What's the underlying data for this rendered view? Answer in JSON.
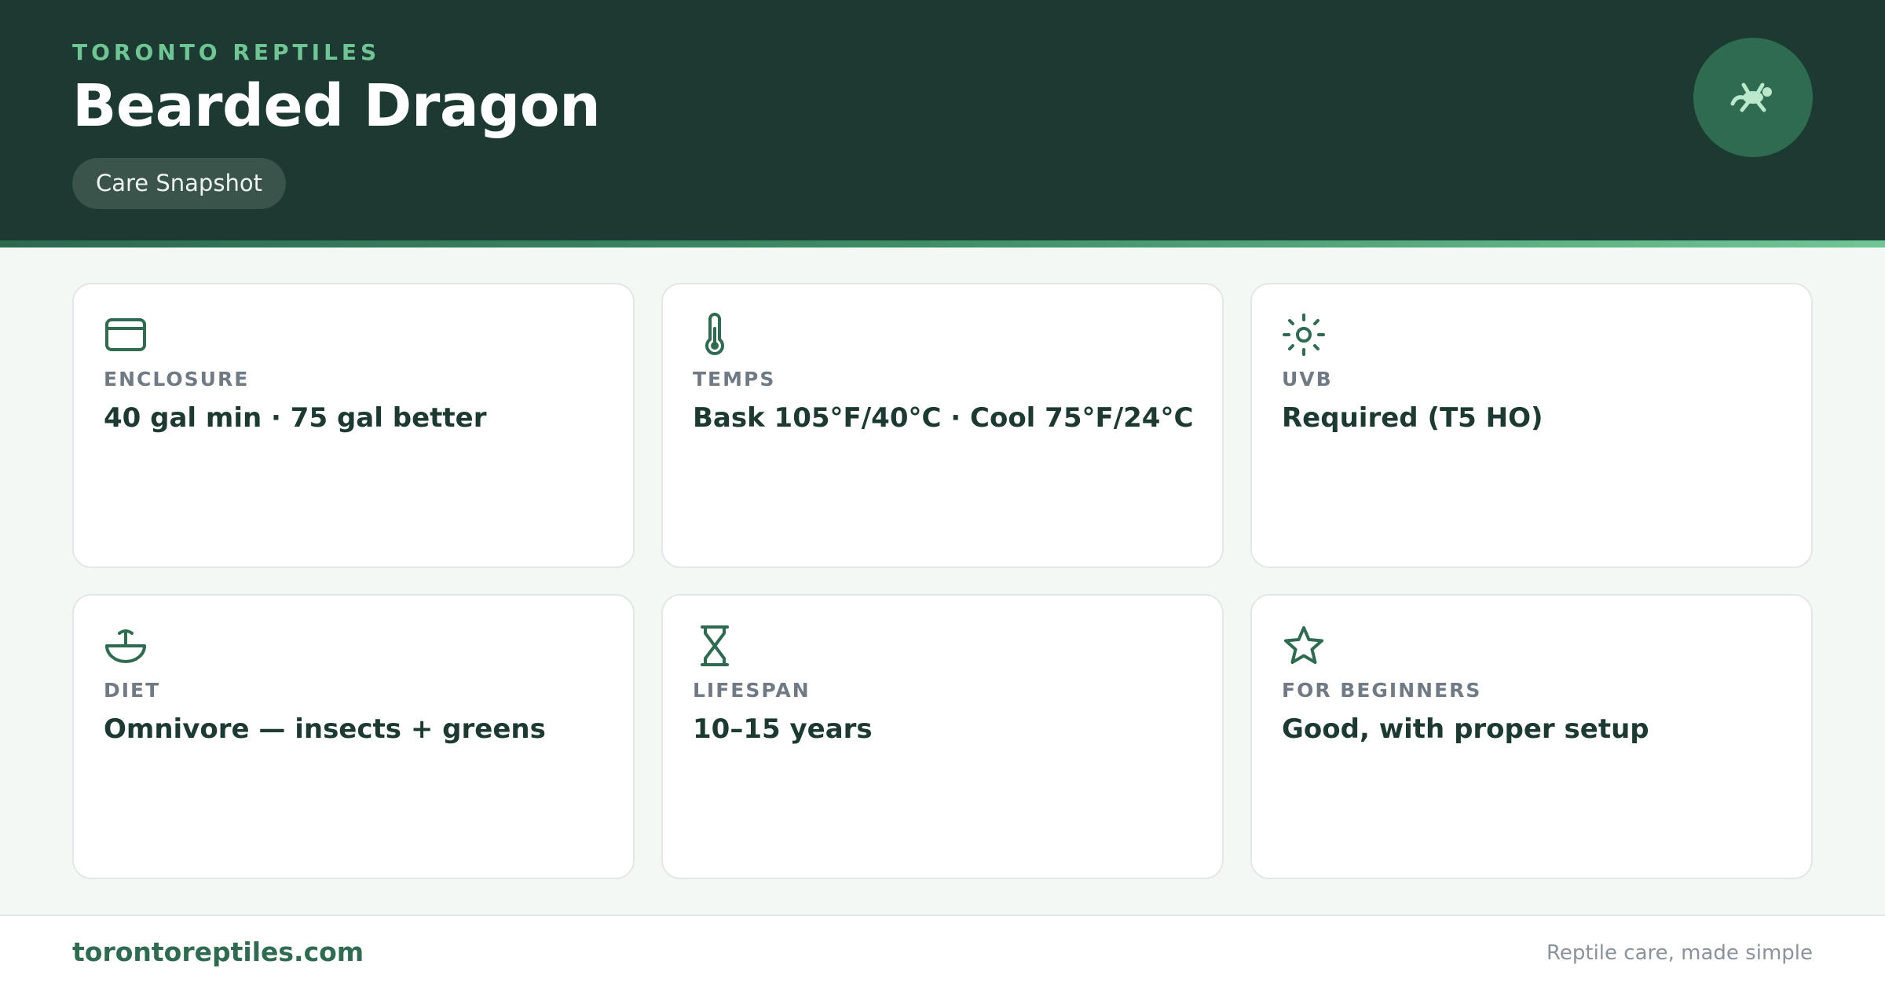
{
  "header": {
    "brand": "TORONTO REPTILES",
    "title": "Bearded Dragon",
    "badge": "Care Snapshot",
    "logo_icon": "lizard-icon"
  },
  "cards": [
    {
      "icon": "enclosure-icon",
      "label": "ENCLOSURE",
      "value": "40 gal min · 75 gal better"
    },
    {
      "icon": "thermometer-icon",
      "label": "TEMPS",
      "value": "Bask 105°F/40°C · Cool 75°F/24°C"
    },
    {
      "icon": "sun-icon",
      "label": "UVB",
      "value": "Required (T5 HO)"
    },
    {
      "icon": "bowl-icon",
      "label": "DIET",
      "value": "Omnivore — insects + greens"
    },
    {
      "icon": "hourglass-icon",
      "label": "LIFESPAN",
      "value": "10–15 years"
    },
    {
      "icon": "star-icon",
      "label": "FOR BEGINNERS",
      "value": "Good, with proper setup"
    }
  ],
  "footer": {
    "site": "torontoreptiles.com",
    "tagline": "Reptile care, made simple"
  },
  "colors": {
    "header_bg": "#1c3a31",
    "accent": "#6fc694",
    "icon": "#2e6b50",
    "value_text": "#1c3a31"
  }
}
